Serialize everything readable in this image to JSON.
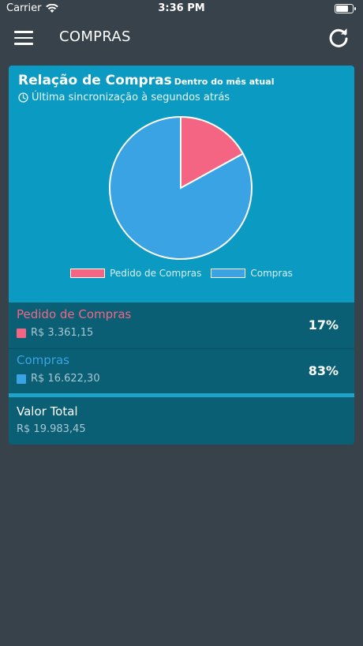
{
  "status": {
    "carrier": "Carrier",
    "time": "3:36 PM",
    "battery_level": 0.9
  },
  "nav": {
    "title": "COMPRAS",
    "menu_icon": "hamburger-menu-icon",
    "refresh_icon": "refresh-icon"
  },
  "card": {
    "title": "Relação de Compras",
    "subtitle": "Dentro do mês atual",
    "sync_text": "Última sincronização à segundos atrás",
    "sync_icon": "clock-icon"
  },
  "chart_data": {
    "type": "pie",
    "labels": [
      "Pedido de Compras",
      "Compras"
    ],
    "values": [
      17,
      83
    ],
    "colors": [
      "#f46583",
      "#3aa3e3"
    ]
  },
  "rows": [
    {
      "name": "Pedido de Compras",
      "value": "R$ 3.361,15",
      "pct": "17%",
      "color": "#f46583"
    },
    {
      "name": "Compras",
      "value": "R$ 16.622,30",
      "pct": "83%",
      "color": "#3aa3e3"
    }
  ],
  "total": {
    "label": "Valor Total",
    "value": "R$ 19.983,45"
  }
}
